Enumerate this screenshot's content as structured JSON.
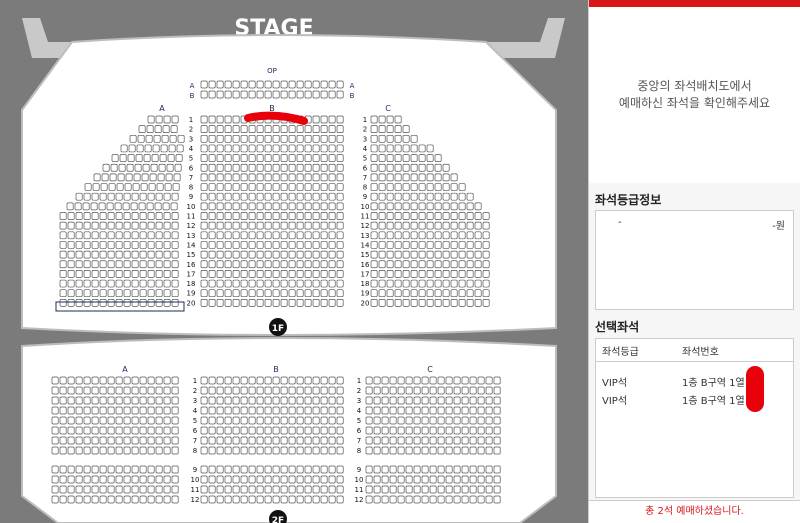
{
  "seatmap": {
    "stage_label": "STAGE",
    "floor1_badge": "1F",
    "floor2_badge": "2F",
    "op_label": "OP",
    "op_row_labels": [
      "A",
      "B"
    ],
    "floor1_sections": [
      "A",
      "B",
      "C"
    ],
    "floor2_sections": [
      "A",
      "B",
      "C"
    ],
    "floor1_rows": [
      "1",
      "2",
      "3",
      "4",
      "5",
      "6",
      "7",
      "8",
      "9",
      "10",
      "11",
      "12",
      "13",
      "14",
      "15",
      "16",
      "17",
      "18",
      "19",
      "20"
    ],
    "floor2_rows": [
      "1",
      "2",
      "3",
      "4",
      "5",
      "6",
      "7",
      "8",
      "9",
      "10",
      "11",
      "12"
    ],
    "highlight_color": "#e8000a"
  },
  "panel": {
    "notice_line1": "중앙의 좌석배치도에서",
    "notice_line2": "예매하신 좌석을 확인해주세요",
    "grade_title": "좌석등급정보",
    "grade_name": "-",
    "grade_price": "-원",
    "selected_title": "선택좌석",
    "col_grade": "좌석등급",
    "col_number": "좌석번호",
    "selected_seats": [
      {
        "grade": "VIP석",
        "seat": "1층 B구역 1열"
      },
      {
        "grade": "VIP석",
        "seat": "1층 B구역 1열"
      }
    ],
    "footer": "총 2석 예매하셨습니다."
  },
  "colors": {
    "accent": "#d9151b",
    "seat_fill": "#ffffff",
    "background": "#7b7b7b"
  }
}
